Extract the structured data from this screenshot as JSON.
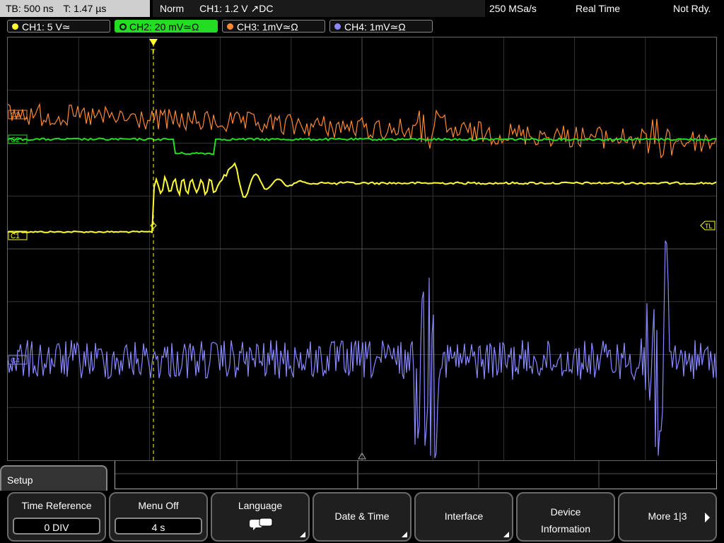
{
  "topbar": {
    "timebase": "TB: 500 ns",
    "trigger_time": "T: 1.47 µs",
    "trigger_mode": "Norm",
    "trigger_source": "CH1: 1.2 V ↗DC",
    "sample_rate": "250 MSa/s",
    "acq_mode": "Real Time",
    "status": "Not Rdy."
  },
  "channels": [
    {
      "label": "CH1: 5 V≃",
      "color": "#ffff33"
    },
    {
      "label": "CH2: 20 mV≃Ω",
      "color": "#22dd22"
    },
    {
      "label": "CH3: 1mV≃Ω",
      "color": "#ff8833"
    },
    {
      "label": "CH4: 1mV≃Ω",
      "color": "#8888ff"
    }
  ],
  "markers": {
    "ch1": "C1",
    "ch2": "C2",
    "ch3": "C3",
    "ch4": "C4",
    "trigger_level": "TL",
    "trigger": "T"
  },
  "menu": {
    "title": "Setup",
    "keys": [
      {
        "label": "Time Reference",
        "value": "0 DIV"
      },
      {
        "label": "Menu Off",
        "value": "4 s"
      },
      {
        "label": "Language"
      },
      {
        "label": "Date & Time"
      },
      {
        "label": "Interface"
      },
      {
        "label": "Device",
        "label2": "Information"
      },
      {
        "label": "More 1|3"
      }
    ]
  },
  "icons": {
    "language": "speech-bubbles-icon",
    "submenu": "corner-triangle-icon",
    "next": "arrow-right-icon"
  }
}
